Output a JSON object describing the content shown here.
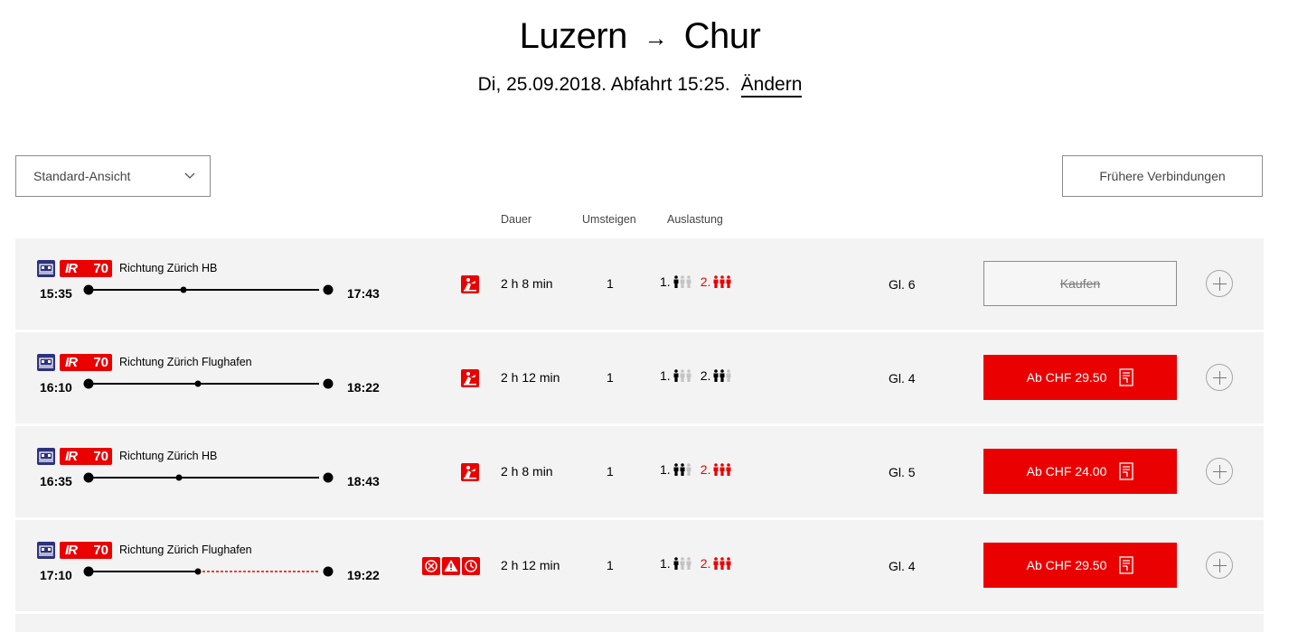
{
  "header": {
    "from": "Luzern",
    "arrow": "→",
    "to": "Chur",
    "date_line": "Di, 25.09.2018. Abfahrt 15:25.",
    "change_label": "Ändern"
  },
  "toolbar": {
    "view_select": "Standard-Ansicht",
    "earlier_label": "Frühere Verbindungen"
  },
  "columns": {
    "duration": "Dauer",
    "transfers": "Umsteigen",
    "occupancy": "Auslastung"
  },
  "colors": {
    "accent": "#eb0000",
    "loco": "#2d327d",
    "row_bg": "#f3f3f3"
  },
  "connections": [
    {
      "train": "IR",
      "line": "70",
      "direction": "Richtung Zürich HB",
      "departure": "15:35",
      "arrival": "17:43",
      "delay_segment": false,
      "icons": [
        "construction-icon"
      ],
      "duration": "2 h 8 min",
      "transfers": "1",
      "class1_label": "1.",
      "class1_level": 1,
      "class2_label": "2.",
      "class2_level": 3,
      "track": "Gl. 6",
      "buy_label": "Kaufen",
      "buy_enabled": false
    },
    {
      "train": "IR",
      "line": "70",
      "direction": "Richtung Zürich Flughafen",
      "departure": "16:10",
      "arrival": "18:22",
      "delay_segment": false,
      "icons": [
        "construction-icon"
      ],
      "duration": "2 h 12 min",
      "transfers": "1",
      "class1_label": "1.",
      "class1_level": 1,
      "class2_label": "2.",
      "class2_level": 2,
      "track": "Gl. 4",
      "buy_label": "Ab CHF 29.50",
      "buy_enabled": true
    },
    {
      "train": "IR",
      "line": "70",
      "direction": "Richtung Zürich HB",
      "departure": "16:35",
      "arrival": "18:43",
      "delay_segment": false,
      "icons": [
        "construction-icon"
      ],
      "duration": "2 h 8 min",
      "transfers": "1",
      "class1_label": "1.",
      "class1_level": 2,
      "class2_label": "2.",
      "class2_level": 3,
      "track": "Gl. 5",
      "buy_label": "Ab CHF 24.00",
      "buy_enabled": true
    },
    {
      "train": "IR",
      "line": "70",
      "direction": "Richtung Zürich Flughafen",
      "departure": "17:10",
      "arrival": "19:22",
      "delay_segment": true,
      "icons": [
        "cancelled-icon",
        "warning-icon",
        "clock-icon"
      ],
      "duration": "2 h 12 min",
      "transfers": "1",
      "class1_label": "1.",
      "class1_level": 1,
      "class2_label": "2.",
      "class2_level": 3,
      "track": "Gl. 4",
      "buy_label": "Ab CHF 29.50",
      "buy_enabled": true
    }
  ]
}
